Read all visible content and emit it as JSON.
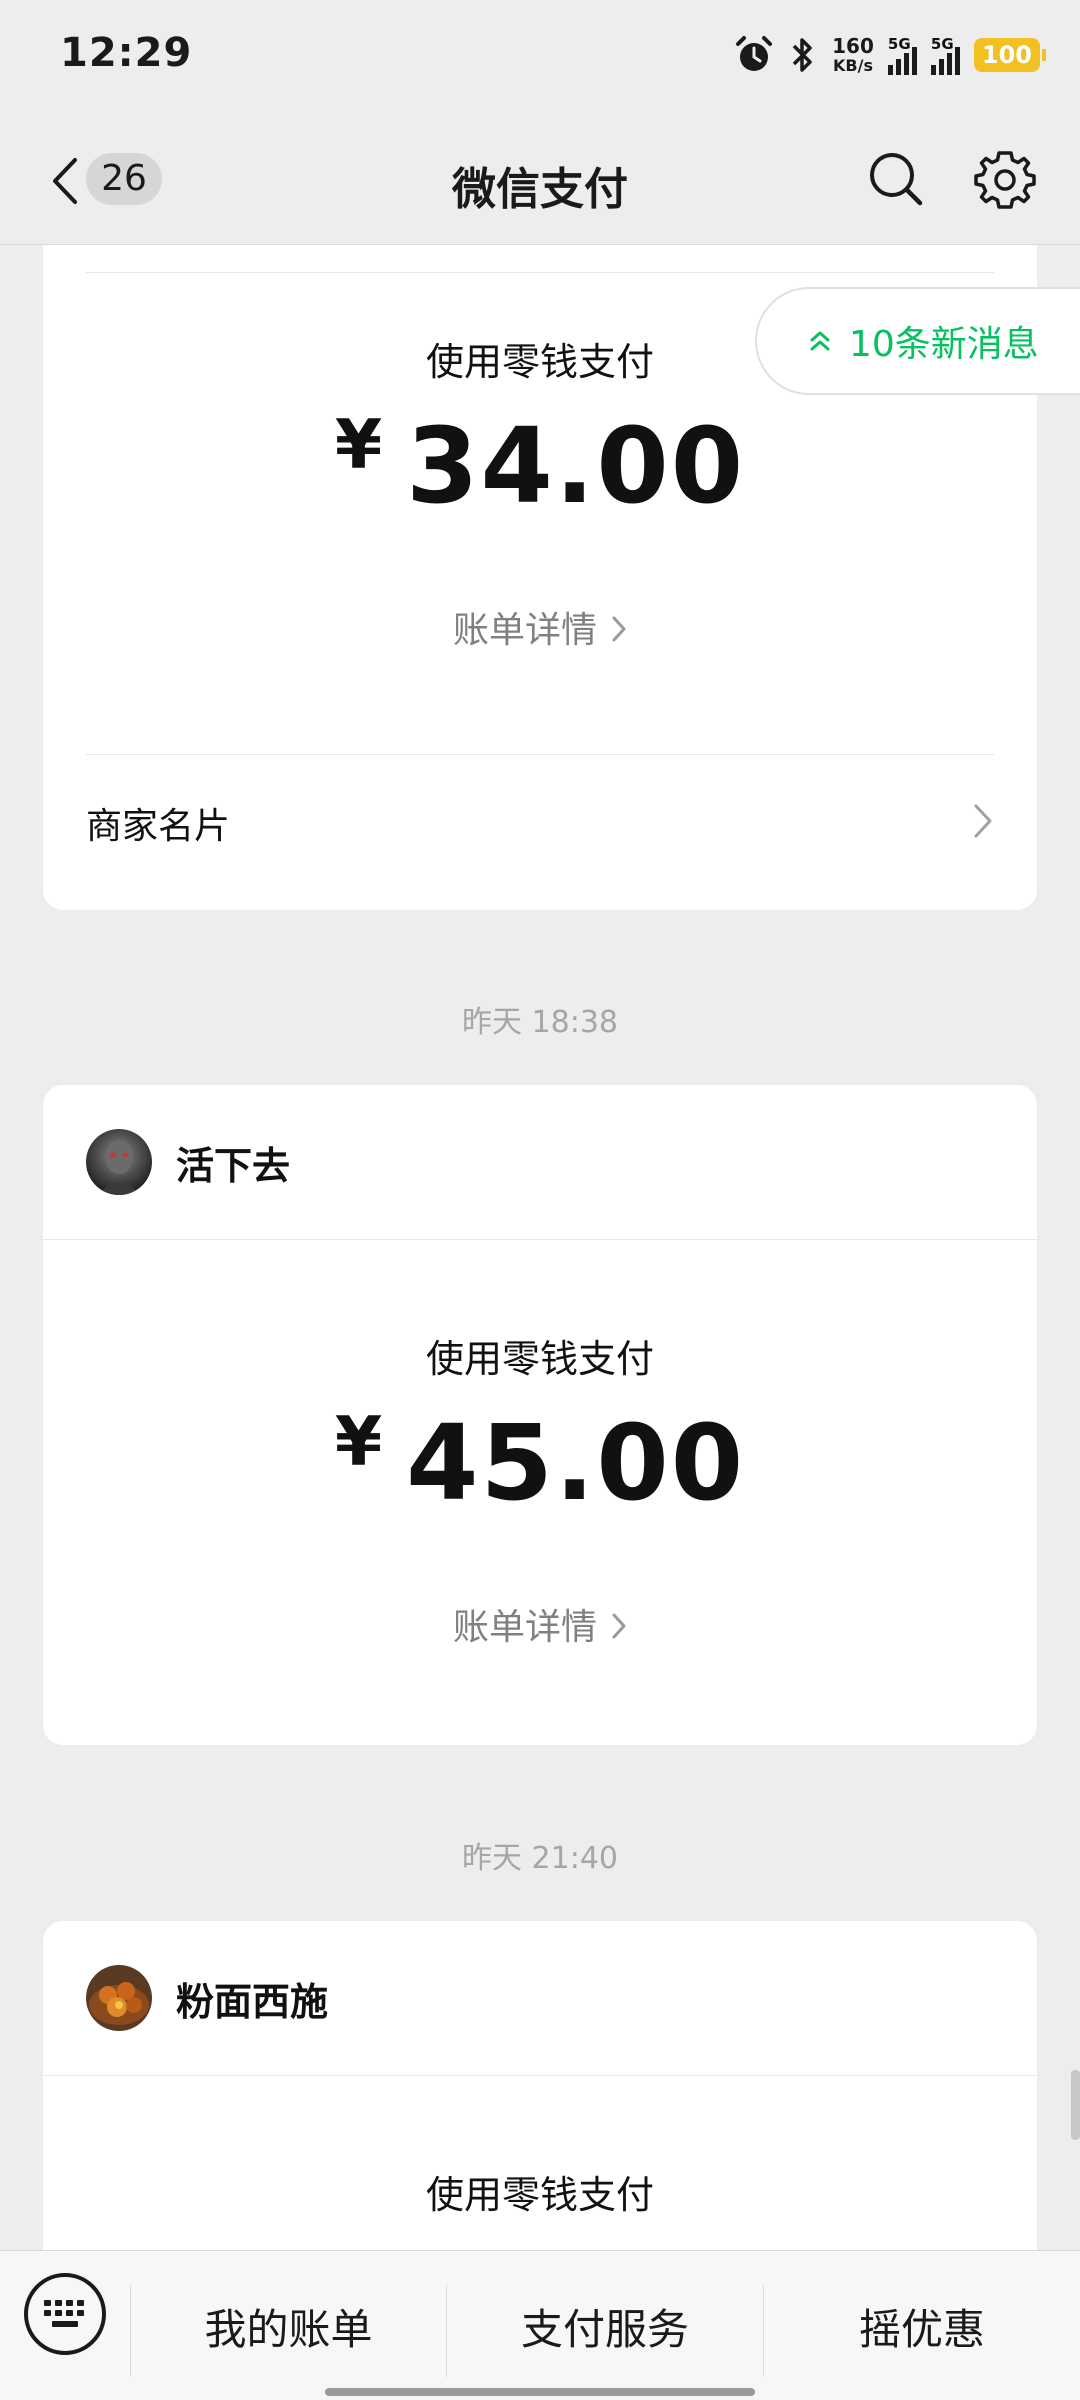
{
  "status_bar": {
    "time": "12:29",
    "net_speed_value": "160",
    "net_speed_unit": "KB/s",
    "sim1": "5G",
    "sim2": "5G",
    "battery": "100"
  },
  "nav": {
    "unread_count": "26",
    "title": "微信支付"
  },
  "new_messages": "10条新消息",
  "payments": [
    {
      "method": "使用零钱支付",
      "currency": "¥",
      "amount": "34.00",
      "detail_label": "账单详情",
      "merchant_card_label": "商家名片"
    },
    {
      "timestamp": "昨天 18:38",
      "merchant": "活下去",
      "method": "使用零钱支付",
      "currency": "¥",
      "amount": "45.00",
      "detail_label": "账单详情"
    },
    {
      "timestamp": "昨天 21:40",
      "merchant": "粉面西施",
      "method": "使用零钱支付"
    }
  ],
  "bottom_menu": {
    "items": [
      "我的账单",
      "支付服务",
      "摇优惠"
    ]
  },
  "colors": {
    "accent": "#07c160",
    "background": "#ededed",
    "battery": "#f3c021"
  }
}
